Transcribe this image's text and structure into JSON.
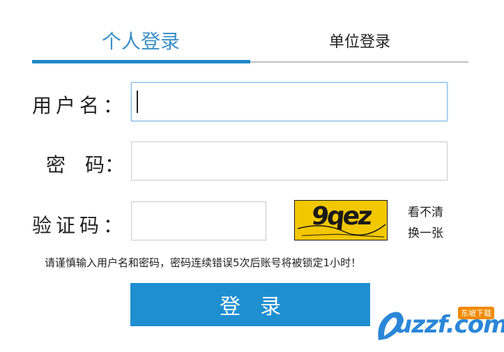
{
  "tabs": {
    "personal": "个人登录",
    "unit": "单位登录"
  },
  "form": {
    "username_label": "用户名：",
    "password_label": "密　码：",
    "captcha_label": "验证码：",
    "username_value": "",
    "password_value": "",
    "captcha_value": ""
  },
  "captcha": {
    "text": "9qez",
    "refresh_line1": "看不清",
    "refresh_line2": "换一张"
  },
  "warning": "请谨慎输入用户名和密码，密码连续错误5次后账号将被锁定1小时！",
  "login_button": "登录",
  "watermark": {
    "brand": "uzzf.com",
    "badge": "东坡下载"
  },
  "colors": {
    "accent": "#1e88c8",
    "button": "#1e8fd0",
    "captcha_bg": "#f3c700"
  }
}
